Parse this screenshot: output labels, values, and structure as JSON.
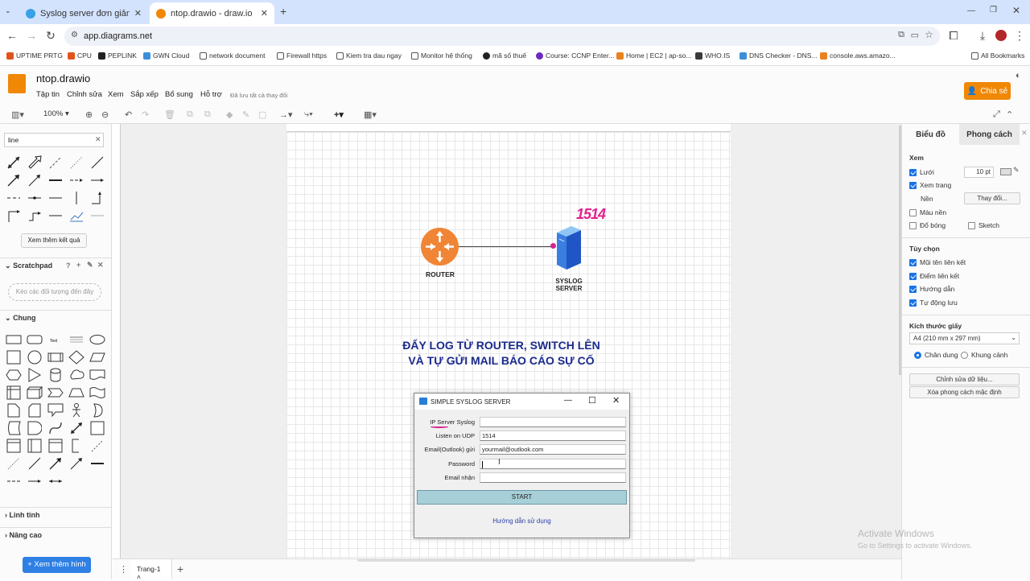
{
  "browser": {
    "tabs": [
      {
        "title": "Syslog server đơn giản để giám",
        "active": false
      },
      {
        "title": "ntop.drawio - draw.io",
        "active": true
      }
    ],
    "url": "app.diagrams.net",
    "bookmarks": [
      "UPTIME PRTG",
      "CPU",
      "PEPLINK",
      "GWN Cloud",
      "network document",
      "Firewall https",
      "Kiem tra dau ngay",
      "Monitor hệ thống",
      "mã số thuế",
      "Course: CCNP Enter...",
      "Home | EC2 | ap-so...",
      "WHO.IS",
      "DNS Checker - DNS...",
      "console.aws.amazo...",
      "All Bookmarks"
    ]
  },
  "app": {
    "doc_title": "ntop.drawio",
    "menus": [
      "Tập tin",
      "Chỉnh sửa",
      "Xem",
      "Sắp xếp",
      "Bổ sung",
      "Hỗ trợ"
    ],
    "saved_status": "Đã lưu tất cả thay đổi",
    "share_label": "Chia sẻ",
    "zoom": "100%",
    "accent": "#f08705"
  },
  "left": {
    "search_value": "line",
    "more_results": "Xem thêm kết quả",
    "scratchpad": "Scratchpad",
    "scratch_hint": "Kéo các đối tượng đến đây",
    "general": "Chung",
    "misc": "Linh tinh",
    "advanced": "Nâng cao",
    "more_shapes": "+ Xem thêm hình"
  },
  "right": {
    "tab_diagram": "Biểu đồ",
    "tab_style": "Phong cách",
    "view": "Xem",
    "grid": "Lưới",
    "grid_size": "10 pt",
    "page_view": "Xem trang",
    "background": "Nền",
    "change": "Thay đổi...",
    "bg_color": "Màu nền",
    "shadow": "Đổ bóng",
    "sketch": "Sketch",
    "options": "Tùy chọn",
    "conn_arrows": "Mũi tên liên kết",
    "conn_points": "Điểm liên kết",
    "guides": "Hướng dẫn",
    "autosave": "Tự động lưu",
    "paper_size": "Kích thước giấy",
    "paper_value": "A4 (210 mm x 297 mm)",
    "portrait": "Chân dung",
    "landscape": "Khung cảnh",
    "edit_data": "Chỉnh sửa dữ liệu...",
    "clear_style": "Xóa phong cách mặc định"
  },
  "diagram": {
    "router_label": "ROUTER",
    "server_label_1": "SYSLOG",
    "server_label_2": "SERVER",
    "annotation": "1514",
    "headline_1": "ĐẨY LOG TỪ ROUTER, SWITCH LÊN",
    "headline_2": "VÀ TỰ GỬI MAIL BÁO CÁO SỰ CỐ"
  },
  "dialog": {
    "title": "SIMPLE SYSLOG SERVER",
    "fields": [
      {
        "label": "IP Server Syslog",
        "value": ""
      },
      {
        "label": "Listen on UDP",
        "value": "1514"
      },
      {
        "label": "Email(Outlook) gửi",
        "value": "yourmail@outlook.com"
      },
      {
        "label": "Password",
        "value": ""
      },
      {
        "label": "Email nhận",
        "value": ""
      }
    ],
    "start": "START",
    "guide": "Hướng dẫn sử dụng"
  },
  "page_tab": "Trang-1",
  "watermark": {
    "line1": "Activate Windows",
    "line2": "Go to Settings to activate Windows."
  }
}
